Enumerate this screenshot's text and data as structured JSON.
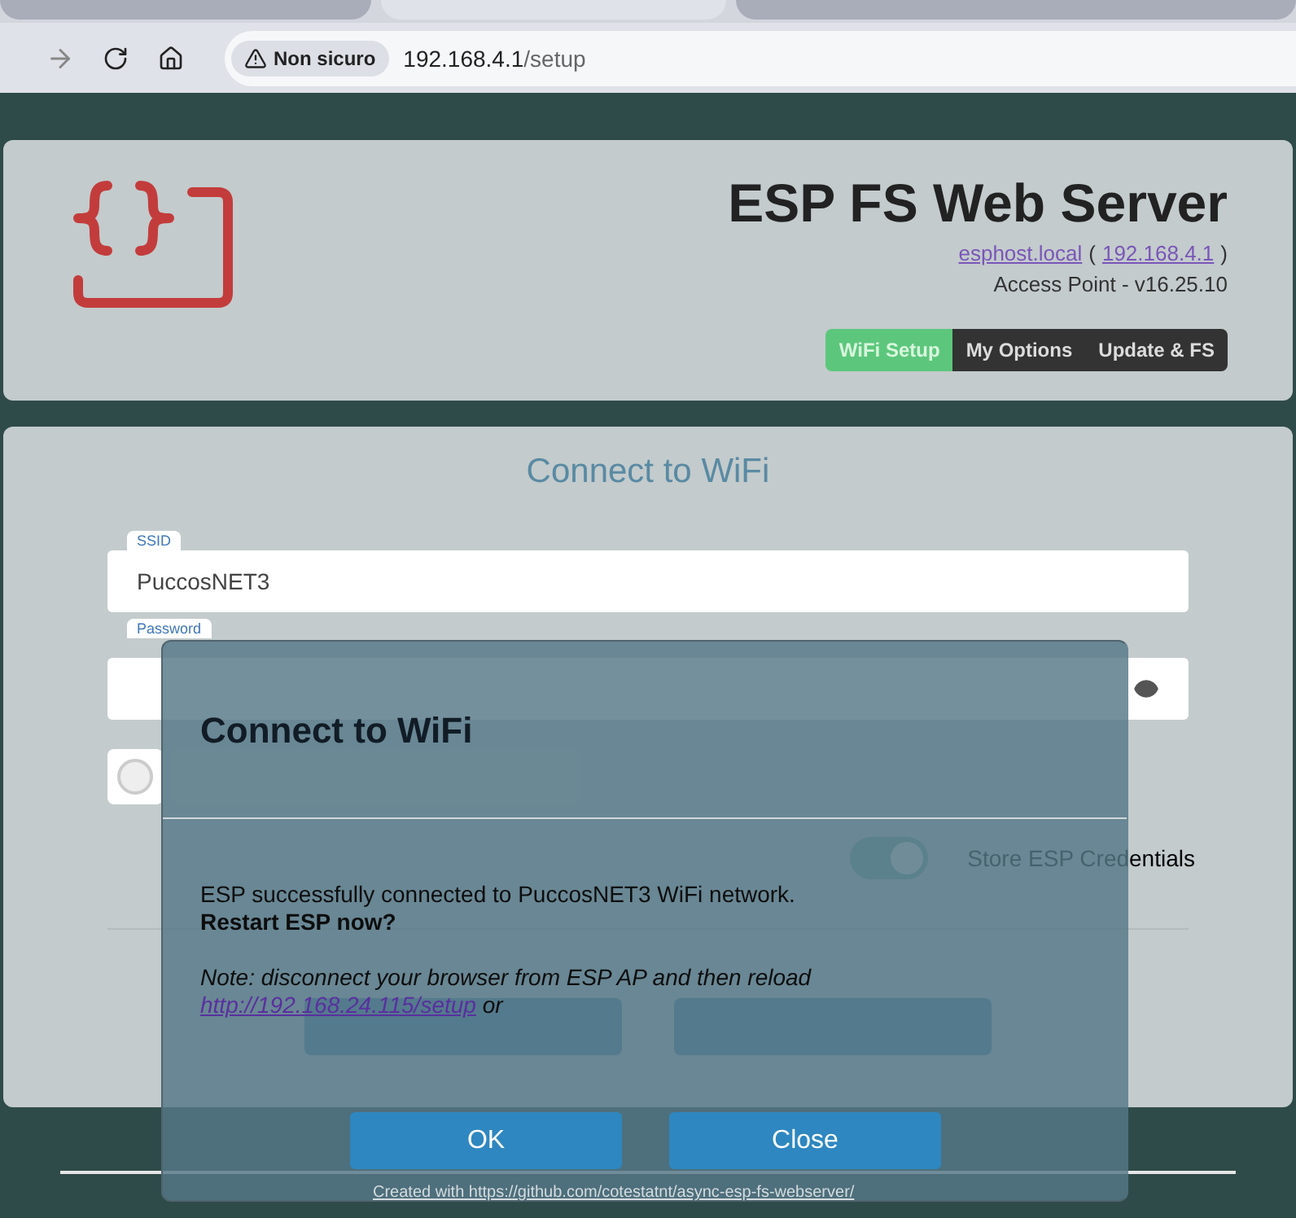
{
  "browser": {
    "tabs": [
      {
        "selected": false
      },
      {
        "selected": true
      },
      {
        "selected": false
      }
    ],
    "security_label": "Non sicuro",
    "host": "192.168.4.1",
    "path": "/setup"
  },
  "header": {
    "title": "ESP FS Web Server",
    "host_link": "esphost.local",
    "paren_open": "(",
    "ip_link": "192.168.4.1",
    "paren_close": ")",
    "mode": "Access Point - v16.25.10",
    "menu": [
      {
        "label": "WiFi Setup",
        "selected": true
      },
      {
        "label": "My Options",
        "selected": false
      },
      {
        "label": "Update & FS",
        "selected": false
      }
    ]
  },
  "form": {
    "title": "Connect to WiFi",
    "ssid": {
      "label": "SSID",
      "value": "PuccosNET3"
    },
    "password": {
      "label": "Password"
    },
    "option": {
      "checked": false
    },
    "store_credentials": {
      "label": "Store ESP Credentials",
      "on": true
    }
  },
  "modal": {
    "title": "Connect to WiFi",
    "message": "ESP successfully connected to PuccosNET3 WiFi network.",
    "question": "Restart ESP now?",
    "note": "Note: disconnect your browser from ESP AP and then reload",
    "note_link": "http://192.168.24.115/setup",
    "note_tail": "or",
    "buttons": [
      {
        "label": "OK"
      },
      {
        "label": "Close"
      }
    ]
  },
  "footer": {
    "link": "Created with https://github.com/cotestatnt/async-esp-fs-webserver/"
  }
}
